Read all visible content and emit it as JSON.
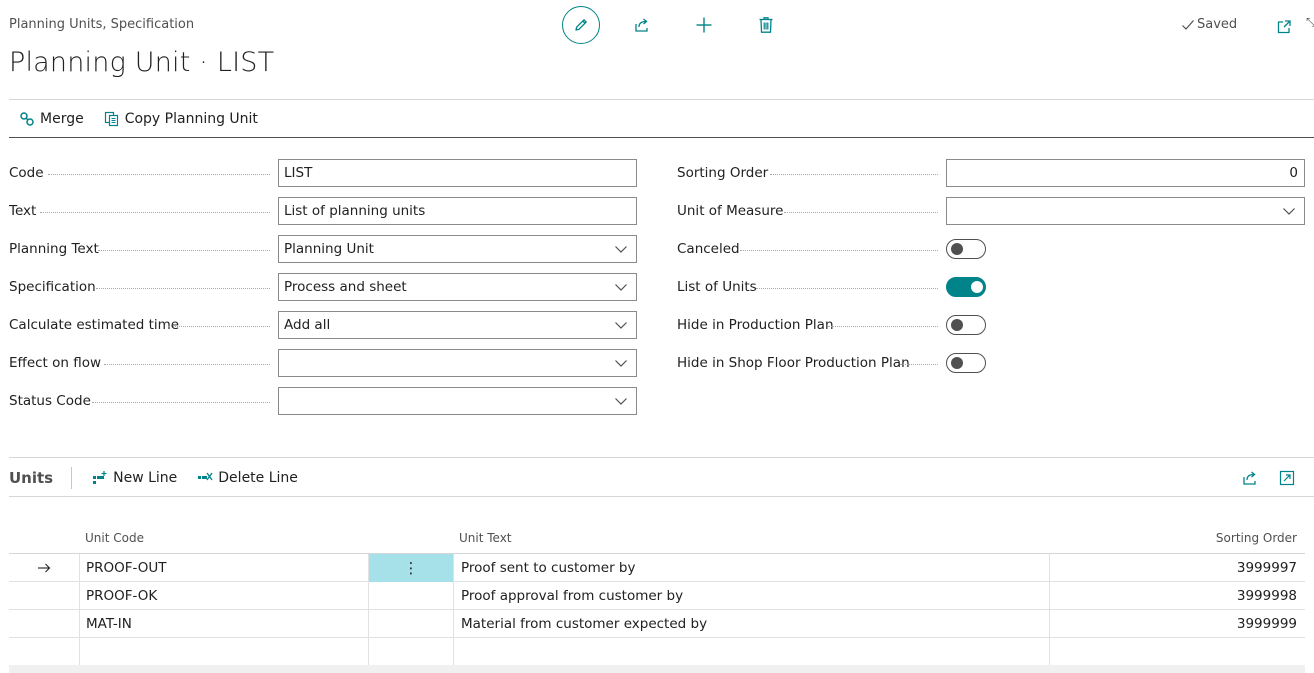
{
  "header": {
    "breadcrumb": "Planning Units, Specification",
    "title": "Planning Unit · LIST",
    "saved_label": "Saved"
  },
  "actions": {
    "merge": "Merge",
    "copy": "Copy Planning Unit"
  },
  "fields_left": [
    {
      "label": "Code",
      "value": "LIST",
      "type": "text"
    },
    {
      "label": "Text",
      "value": "List of planning units",
      "type": "text"
    },
    {
      "label": "Planning Text",
      "value": "Planning Unit",
      "type": "select"
    },
    {
      "label": "Specification",
      "value": "Process and sheet",
      "type": "select"
    },
    {
      "label": "Calculate estimated time",
      "value": "Add all",
      "type": "select"
    },
    {
      "label": "Effect on flow",
      "value": "",
      "type": "select"
    },
    {
      "label": "Status Code",
      "value": "",
      "type": "select"
    }
  ],
  "fields_right": [
    {
      "label": "Sorting Order",
      "value": "0",
      "type": "number"
    },
    {
      "label": "Unit of Measure",
      "value": "",
      "type": "select"
    },
    {
      "label": "Canceled",
      "checked": false,
      "type": "toggle"
    },
    {
      "label": "List of Units",
      "checked": true,
      "type": "toggle"
    },
    {
      "label": "Hide in Production Plan",
      "checked": false,
      "type": "toggle"
    },
    {
      "label": "Hide in Shop Floor Production Plan",
      "checked": false,
      "type": "toggle"
    }
  ],
  "units": {
    "title": "Units",
    "new_line": "New Line",
    "delete_line": "Delete Line",
    "columns": {
      "code": "Unit Code",
      "text": "Unit Text",
      "sort": "Sorting Order"
    },
    "rows": [
      {
        "code": "PROOF-OUT",
        "text": "Proof sent to customer by",
        "sort": "3999997"
      },
      {
        "code": "PROOF-OK",
        "text": "Proof approval from customer by",
        "sort": "3999998"
      },
      {
        "code": "MAT-IN",
        "text": "Material from customer expected by",
        "sort": "3999999"
      },
      {
        "code": "",
        "text": "",
        "sort": ""
      }
    ]
  },
  "colors": {
    "accent": "#008489",
    "selected_cell": "#a6e1ea"
  }
}
